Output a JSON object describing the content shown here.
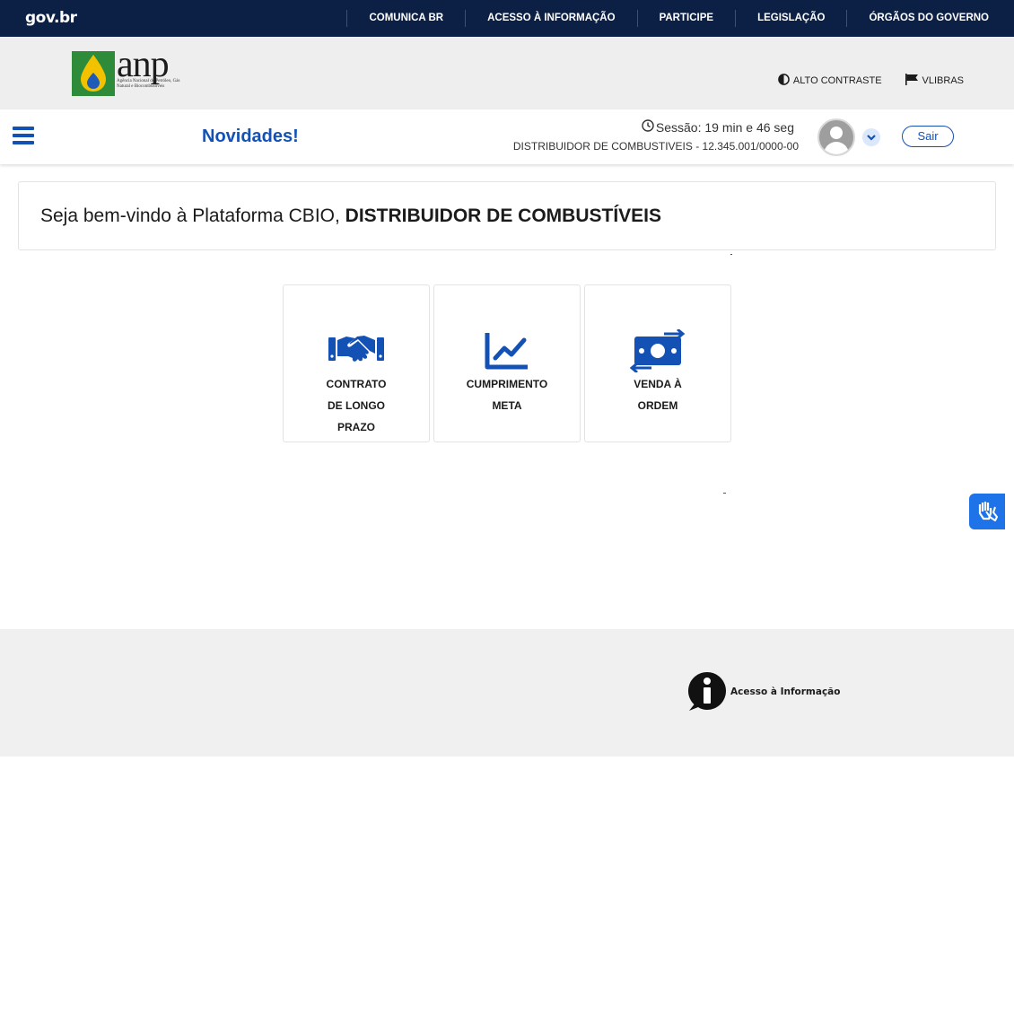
{
  "govbar": {
    "logo": "gov.br",
    "nav": [
      "COMUNICA BR",
      "ACESSO À INFORMAÇÃO",
      "PARTICIPE",
      "LEGISLAÇÃO",
      "ÓRGÃOS DO GOVERNO"
    ]
  },
  "header": {
    "logo_text": "anp",
    "logo_subtitle": "Agência Nacional do Petróleo, Gás Natural e Biocombustíveis",
    "tools": {
      "contrast": "ALTO CONTRASTE",
      "vlibras": "VLIBRAS"
    }
  },
  "appbar": {
    "title": "Novidades!",
    "session": "Sessão: 19 min e 46 seg",
    "company": "DISTRIBUIDOR DE COMBUSTIVEIS - 12.345.001/0000-00",
    "logout": "Sair"
  },
  "welcome": {
    "prefix": "Seja bem-vindo à Plataforma CBIO,",
    "name": "DISTRIBUIDOR DE COMBUSTÍVEIS"
  },
  "tiles": [
    {
      "label": "CONTRATO DE LONGO PRAZO",
      "icon": "handshake-icon"
    },
    {
      "label": "CUMPRIMENTO META",
      "icon": "line-chart-icon"
    },
    {
      "label": "VENDA À ORDEM",
      "icon": "money-exchange-icon"
    }
  ],
  "footer": {
    "access_info": "Acesso à Informação"
  },
  "colors": {
    "primary": "#1351b4",
    "govbar": "#0c1f44",
    "header_bg": "#eeeeee",
    "footer_bg": "#f0f0f0"
  }
}
